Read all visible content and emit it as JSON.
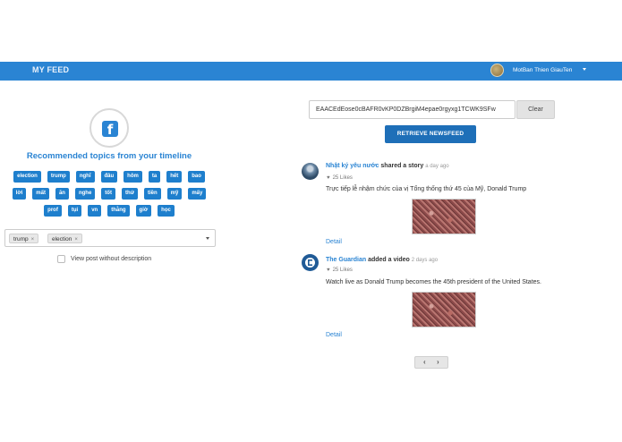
{
  "header": {
    "brand": "MY FEED",
    "username": "MotBan Thien GiauTen"
  },
  "left": {
    "icon": "facebook-icon",
    "title": "Recommended topics from your timeline",
    "tag_rows": [
      [
        "election",
        "trump",
        "nghĩ",
        "đâu",
        "hôm",
        "ta",
        "hết",
        "bao"
      ],
      [
        "lời",
        "mất",
        "ăn",
        "nghe",
        "tốt",
        "thứ",
        "tiền",
        "mỹ",
        "mấy"
      ],
      [
        "prof",
        "tụi",
        "vn",
        "thằng",
        "giờ",
        "học"
      ]
    ],
    "selected_topics": [
      "trump",
      "election"
    ],
    "remove_glyph": "×",
    "checkbox_label": "View post without description"
  },
  "right": {
    "token_value": "EAACEdEose0cBAFR0vKP0DZBrgiM4epae0rgyxg1TCWK9SFw",
    "clear_label": "Clear",
    "retrieve_label": "RETRIEVE NEWSFEED",
    "posts": [
      {
        "author": "Nhật ký yêu nước",
        "action": "shared a story",
        "time": "a day ago",
        "likes": "25 Likes",
        "text": "Trực tiếp lễ nhậm chức của vị Tổng thống thứ 45 của Mỹ, Donald Trump",
        "detail": "Detail"
      },
      {
        "author": "The Guardian",
        "action": "added a video",
        "time": "2 days ago",
        "likes": "25 Likes",
        "text": "Watch live as Donald Trump becomes the 45th president of the United States.",
        "detail": "Detail"
      }
    ],
    "pager": {
      "prev": "‹",
      "next": "›"
    }
  },
  "colors": {
    "accent": "#2a84d3",
    "button": "#1e7fcd"
  }
}
